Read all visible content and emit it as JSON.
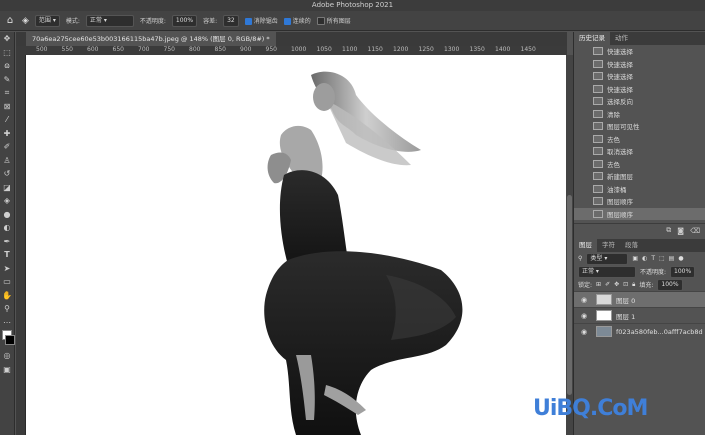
{
  "window": {
    "title": "Adobe Photoshop 2021"
  },
  "options_bar": {
    "brush_size": "30",
    "range_label": "范围",
    "mode_label": "模式:",
    "mode_value": "正常",
    "opacity_label": "不透明度:",
    "opacity_value": "100%",
    "tolerance_label": "容差:",
    "tolerance_value": "32",
    "antialias_label": "消除锯齿",
    "contiguous_label": "连续的",
    "all_layers_label": "所有图层"
  },
  "document": {
    "tab_title": "70a6ea275cee60e53b003166115ba47b.jpeg @ 148% (图层 0, RGB/8#) *"
  },
  "ruler": {
    "ticks": [
      "500",
      "550",
      "600",
      "650",
      "700",
      "750",
      "800",
      "850",
      "900",
      "950",
      "1000",
      "1050",
      "1100",
      "1150",
      "1200",
      "1250",
      "1300",
      "1350",
      "1400",
      "1450"
    ]
  },
  "history_panel": {
    "tabs": [
      "历史记录",
      "动作"
    ],
    "items": [
      "快速选择",
      "快速选择",
      "快速选择",
      "快速选择",
      "选择反向",
      "清除",
      "图层可见性",
      "去色",
      "取消选择",
      "去色",
      "新建图层",
      "油漆桶",
      "图层顺序",
      "图层顺序"
    ],
    "selected_index": 13
  },
  "layers_panel": {
    "tabs": [
      "图层",
      "字符",
      "段落"
    ],
    "filter_label": "类型",
    "blend_mode": "正常",
    "opacity_label": "不透明度:",
    "opacity_value": "100%",
    "lock_label": "锁定:",
    "fill_label": "填充:",
    "fill_value": "100%",
    "layers": [
      {
        "name": "图层 0",
        "visible": true,
        "selected": true
      },
      {
        "name": "图层 1",
        "visible": true,
        "selected": false
      },
      {
        "name": "f023a580feb...0afff7acb8d",
        "visible": true,
        "selected": false
      }
    ]
  },
  "watermark": {
    "text": "UiBQ.CoM"
  },
  "colors": {
    "accent": "#2f78d6",
    "watermark": "#3f7fd8"
  }
}
